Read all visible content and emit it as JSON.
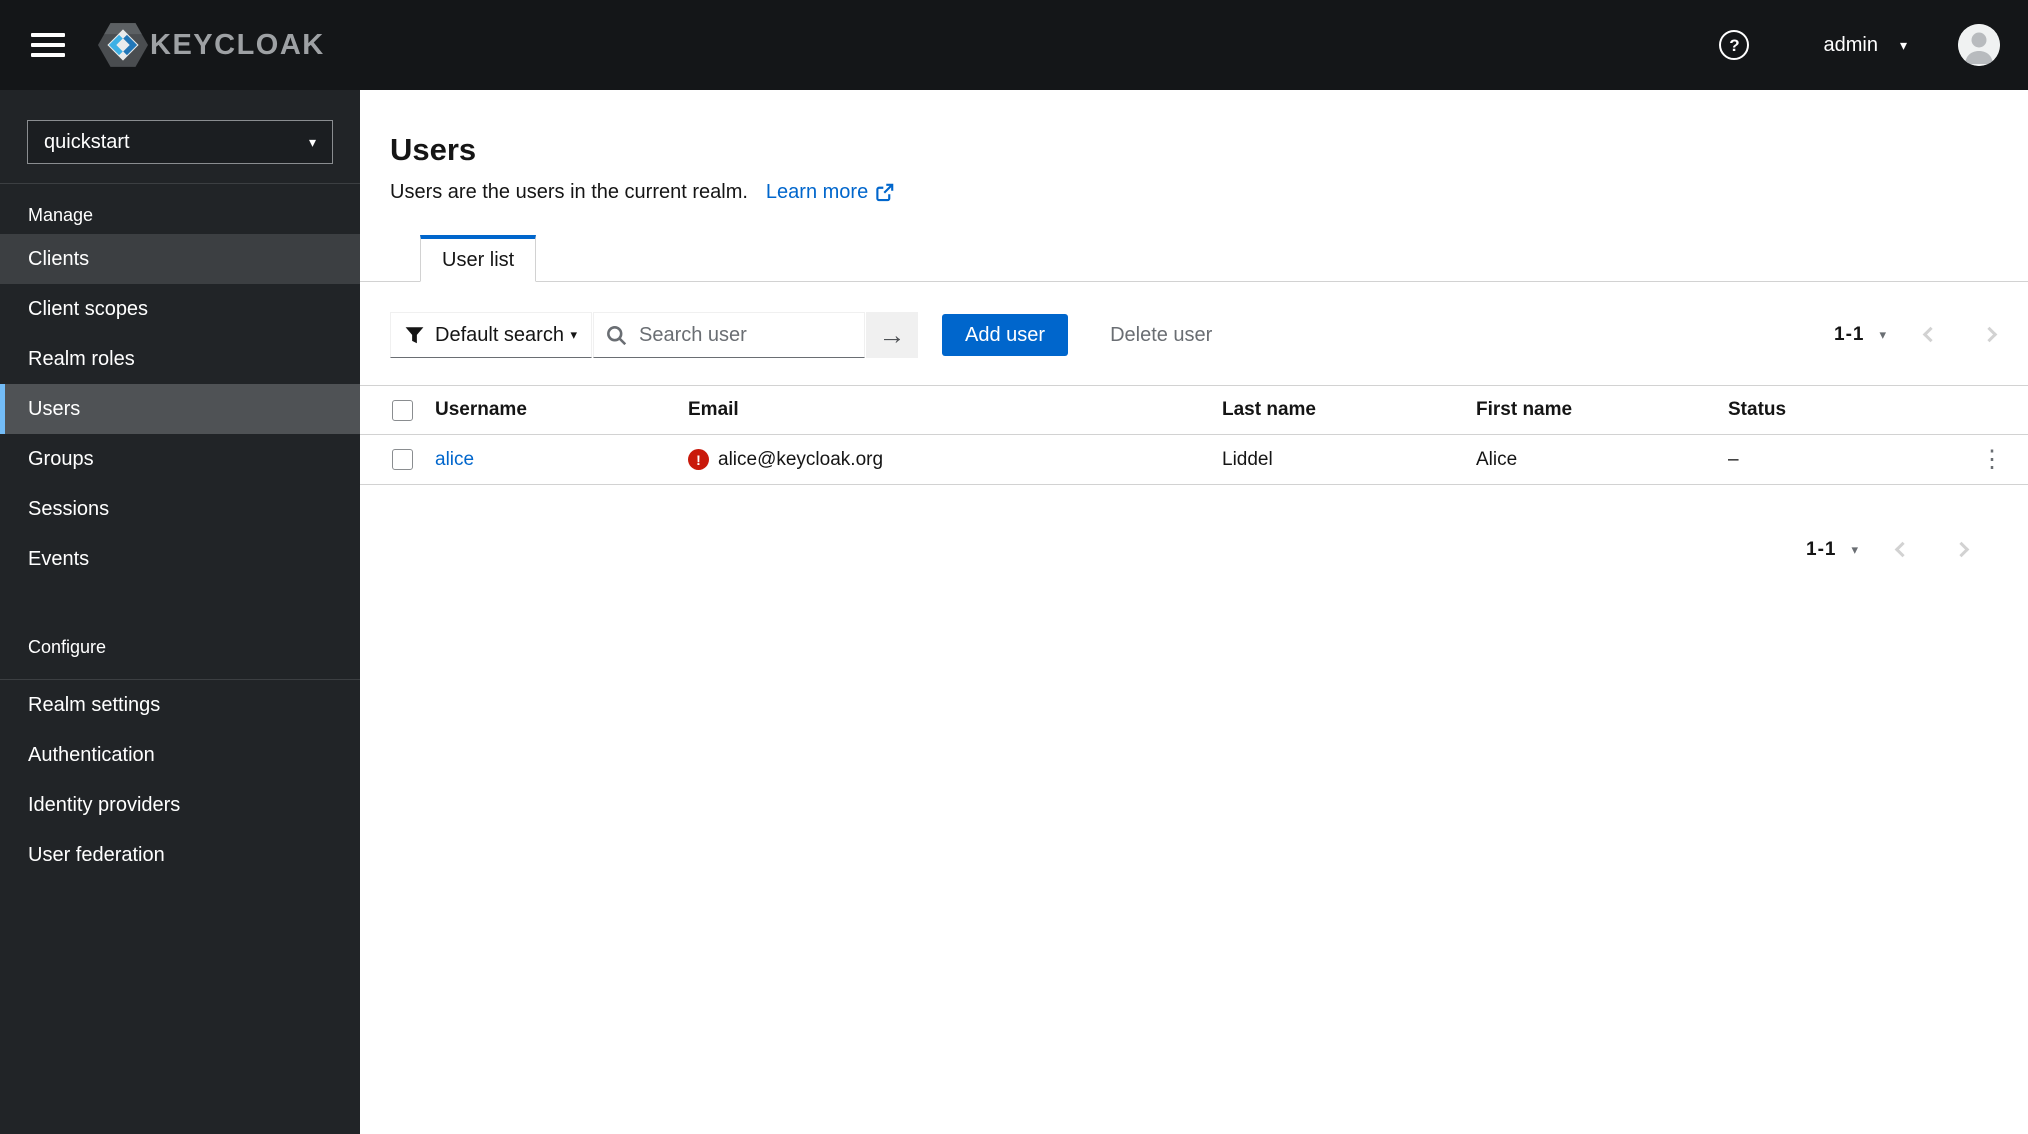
{
  "masthead": {
    "brand": "KEYCLOAK",
    "username": "admin"
  },
  "icons": {
    "help": "?",
    "caret_down": "▾",
    "arrow_right": "→",
    "kebab": "⋮",
    "exclamation": "!"
  },
  "sidebar": {
    "realm": "quickstart",
    "sections": [
      {
        "title": "Manage",
        "items": [
          {
            "label": "Clients"
          },
          {
            "label": "Client scopes"
          },
          {
            "label": "Realm roles"
          },
          {
            "label": "Users"
          },
          {
            "label": "Groups"
          },
          {
            "label": "Sessions"
          },
          {
            "label": "Events"
          }
        ]
      },
      {
        "title": "Configure",
        "items": [
          {
            "label": "Realm settings"
          },
          {
            "label": "Authentication"
          },
          {
            "label": "Identity providers"
          },
          {
            "label": "User federation"
          }
        ]
      }
    ]
  },
  "page": {
    "title": "Users",
    "subtitle": "Users are the users in the current realm.",
    "learn_more_label": "Learn more"
  },
  "tabs": [
    {
      "label": "User list",
      "active": true
    }
  ],
  "toolbar": {
    "filter_label": "Default search",
    "search_placeholder": "Search user",
    "add_user_label": "Add user",
    "delete_user_label": "Delete user"
  },
  "pagination": {
    "top": "1-1",
    "bottom": "1-1"
  },
  "table": {
    "columns": [
      "Username",
      "Email",
      "Last name",
      "First name",
      "Status"
    ],
    "rows": [
      {
        "username": "alice",
        "email": "alice@keycloak.org",
        "email_error": true,
        "last_name": "Liddel",
        "first_name": "Alice",
        "status": "–"
      }
    ]
  },
  "colors": {
    "primary": "#0066cc",
    "danger": "#c9190b",
    "nav_selected_border": "#73bcf7",
    "masthead_bg": "#141618",
    "sidebar_bg": "#212427"
  }
}
